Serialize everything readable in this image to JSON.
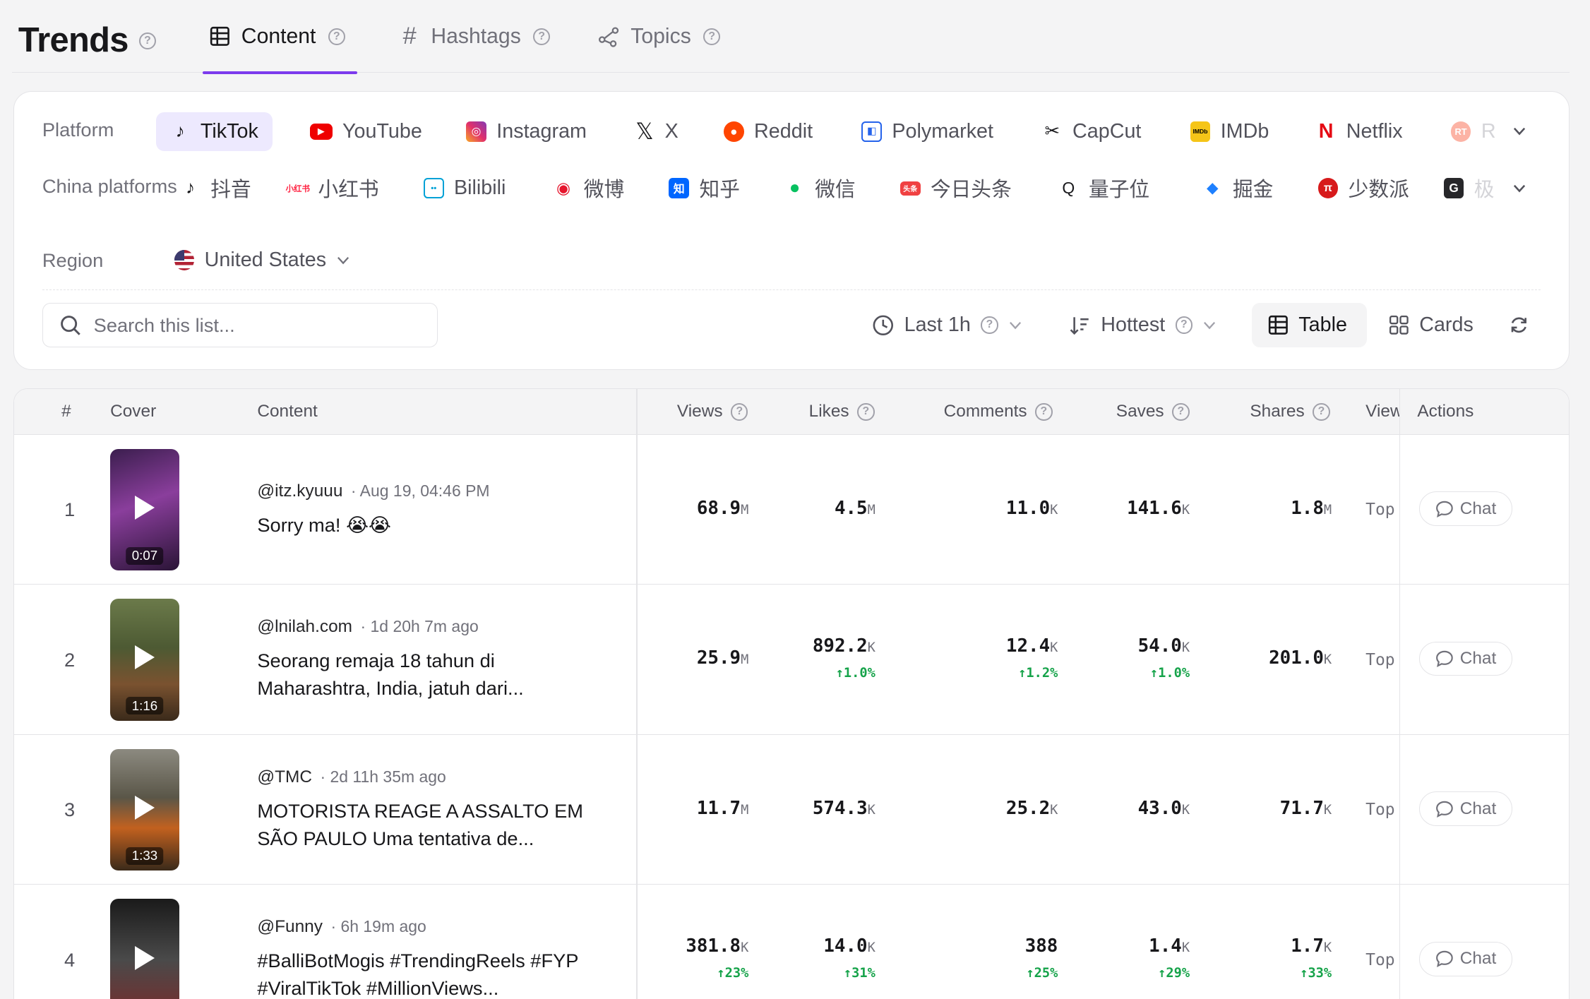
{
  "header": {
    "brand": "Trends",
    "tabs": [
      {
        "label": "Content",
        "active": true,
        "icon": "table-icon"
      },
      {
        "label": "Hashtags",
        "active": false,
        "icon": "hashtag-icon"
      },
      {
        "label": "Topics",
        "active": false,
        "icon": "topics-icon"
      }
    ]
  },
  "filters": {
    "platform_label": "Platform",
    "platforms": [
      "TikTok",
      "YouTube",
      "Instagram",
      "X",
      "Reddit",
      "Polymarket",
      "CapCut",
      "IMDb",
      "Netflix",
      "R"
    ],
    "selected_platform": "TikTok",
    "china_label": "China platforms",
    "china_platforms": [
      "抖音",
      "小红书",
      "Bilibili",
      "微博",
      "知乎",
      "微信",
      "今日头条",
      "量子位",
      "掘金",
      "少数派",
      "极"
    ],
    "region_label": "Region",
    "region": "United States",
    "search_placeholder": "Search this list...",
    "time": "Last 1h",
    "sort": "Hottest",
    "view_table": "Table",
    "view_cards": "Cards",
    "active_view": "Table"
  },
  "colors": {
    "accent": "#7c3aed",
    "positive": "#16a34a"
  },
  "table": {
    "headers": {
      "rank": "#",
      "cover": "Cover",
      "content": "Content",
      "views": "Views",
      "likes": "Likes",
      "comments": "Comments",
      "saves": "Saves",
      "shares": "Shares",
      "view": "View",
      "actions": "Actions"
    },
    "rows": [
      {
        "rank": "1",
        "duration": "0:07",
        "author": "@itz.kyuuu",
        "time": "· Aug 19, 04:46 PM",
        "title": "Sorry ma! 😭😭",
        "views": {
          "v": "68.9",
          "u": "M",
          "d": ""
        },
        "likes": {
          "v": "4.5",
          "u": "M",
          "d": ""
        },
        "comments": {
          "v": "11.0",
          "u": "K",
          "d": ""
        },
        "saves": {
          "v": "141.6",
          "u": "K",
          "d": ""
        },
        "shares": {
          "v": "1.8",
          "u": "M",
          "d": ""
        },
        "view": "Top",
        "action": "Chat"
      },
      {
        "rank": "2",
        "duration": "1:16",
        "author": "@lnilah.com",
        "time": "· 1d 20h 7m ago",
        "title": "Seorang remaja 18 tahun di Maharashtra, India, jatuh dari...",
        "views": {
          "v": "25.9",
          "u": "M",
          "d": ""
        },
        "likes": {
          "v": "892.2",
          "u": "K",
          "d": "↑1.0%"
        },
        "comments": {
          "v": "12.4",
          "u": "K",
          "d": "↑1.2%"
        },
        "saves": {
          "v": "54.0",
          "u": "K",
          "d": "↑1.0%"
        },
        "shares": {
          "v": "201.0",
          "u": "K",
          "d": ""
        },
        "view": "Top",
        "action": "Chat"
      },
      {
        "rank": "3",
        "duration": "1:33",
        "author": "@TMC",
        "time": "· 2d 11h 35m ago",
        "title": "MOTORISTA REAGE A ASSALTO EM SÃO PAULO Uma tentativa de...",
        "views": {
          "v": "11.7",
          "u": "M",
          "d": ""
        },
        "likes": {
          "v": "574.3",
          "u": "K",
          "d": ""
        },
        "comments": {
          "v": "25.2",
          "u": "K",
          "d": ""
        },
        "saves": {
          "v": "43.0",
          "u": "K",
          "d": ""
        },
        "shares": {
          "v": "71.7",
          "u": "K",
          "d": ""
        },
        "view": "Top",
        "action": "Chat"
      },
      {
        "rank": "4",
        "duration": "",
        "author": "@Funny",
        "time": "· 6h 19m ago",
        "title": "#BalliBotMogis #TrendingReels #FYP #ViralTikTok #MillionViews...",
        "views": {
          "v": "381.8",
          "u": "K",
          "d": "↑23%"
        },
        "likes": {
          "v": "14.0",
          "u": "K",
          "d": "↑31%"
        },
        "comments": {
          "v": "388",
          "u": "",
          "d": "↑25%"
        },
        "saves": {
          "v": "1.4",
          "u": "K",
          "d": "↑29%"
        },
        "shares": {
          "v": "1.7",
          "u": "K",
          "d": "↑33%"
        },
        "view": "Top",
        "action": "Chat"
      }
    ]
  }
}
